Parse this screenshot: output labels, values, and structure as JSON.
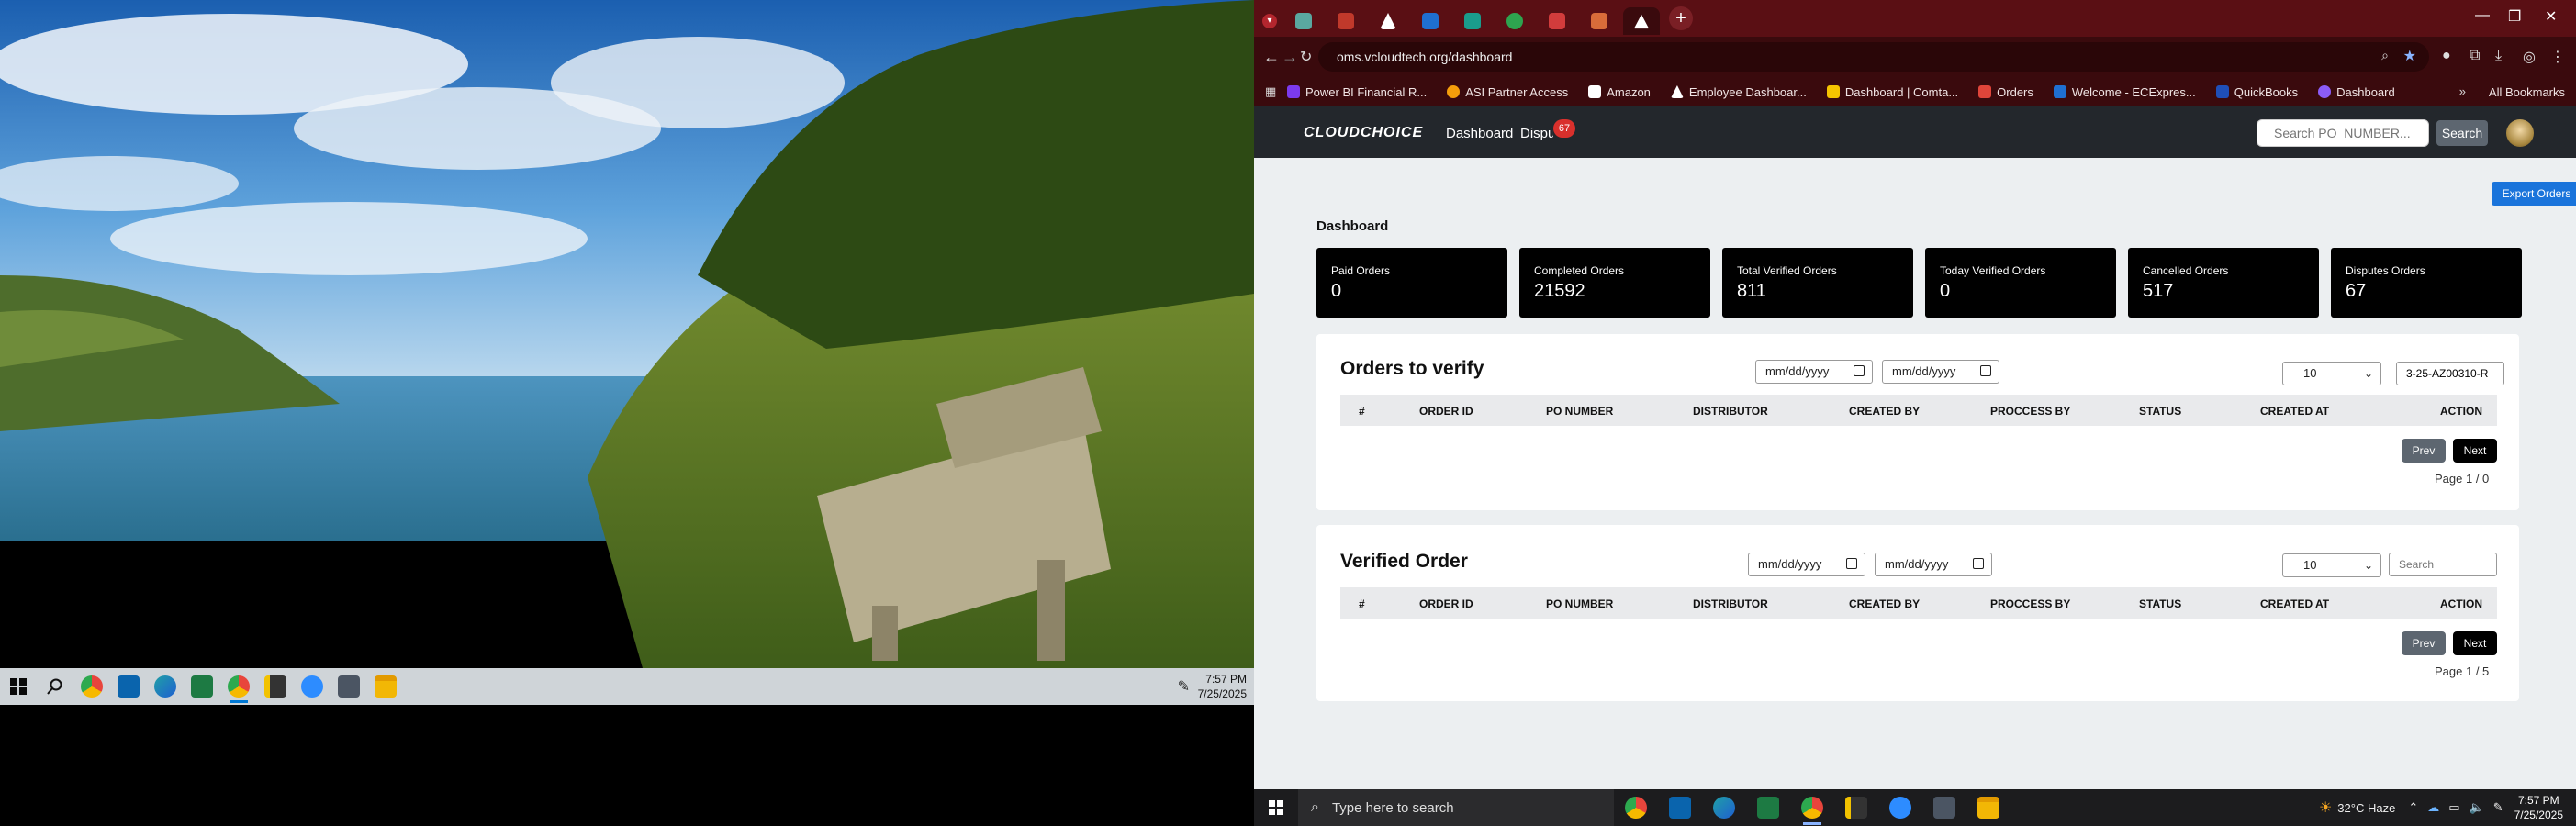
{
  "left_screen": {
    "taskbar": {
      "apps": [
        {
          "name": "windows-start-icon",
          "color": "#0078d4"
        },
        {
          "name": "search-icon",
          "color": "#222222"
        },
        {
          "name": "chrome-icon",
          "color": "#e8453c"
        },
        {
          "name": "outlook-icon",
          "color": "#0a64ad"
        },
        {
          "name": "edge-icon",
          "color": "#1fa0a6"
        },
        {
          "name": "excel-icon",
          "color": "#1d7a43"
        },
        {
          "name": "chrome-profile-icon",
          "color": "#e8453c"
        },
        {
          "name": "sticky-notes-icon",
          "color": "#333333"
        },
        {
          "name": "zoom-icon",
          "color": "#2d8cff"
        },
        {
          "name": "calculator-icon",
          "color": "#4b5563"
        },
        {
          "name": "file-explorer-icon",
          "color": "#f2b705"
        }
      ],
      "time": "7:57 PM",
      "date": "7/25/2025"
    }
  },
  "browser": {
    "tabs": [
      {
        "color": "#5aa8a0"
      },
      {
        "color": "#c0392b"
      },
      {
        "color": "#ffffff"
      },
      {
        "color": "#1f6fd1"
      },
      {
        "color": "#1a9c8c"
      },
      {
        "color": "#2ea44f"
      },
      {
        "color": "#d23c3c"
      },
      {
        "color": "#d86c3a"
      },
      {
        "color": "#ffffff",
        "active": true
      }
    ],
    "url": "oms.vcloudtech.org/dashboard",
    "bookmarks": [
      {
        "label": "Power BI Financial R...",
        "color": "#7c3aed"
      },
      {
        "label": "ASI Partner Access",
        "color": "#f59e0b"
      },
      {
        "label": "Amazon",
        "color": "#111111"
      },
      {
        "label": "Employee Dashboar...",
        "color": "#222222"
      },
      {
        "label": "Dashboard | Comta...",
        "color": "#f5c400"
      },
      {
        "label": "Orders",
        "color": "#e0453a"
      },
      {
        "label": "Welcome - ECExpres...",
        "color": "#1f6fd1"
      },
      {
        "label": "QuickBooks",
        "color": "#1f4fb8"
      },
      {
        "label": "Dashboard",
        "color": "#8b5cf6"
      }
    ],
    "all_bookmarks": "All Bookmarks"
  },
  "app": {
    "logo": "CLOUDCHOICE",
    "nav": {
      "dashboard": "Dashboard",
      "disputes": "Disputes",
      "disputes_badge": "67"
    },
    "search_placeholder": "Search PO_NUMBER...",
    "search_button": "Search",
    "export_button": "Export Orders",
    "page_title": "Dashboard",
    "stats": [
      {
        "label": "Paid Orders",
        "value": "0"
      },
      {
        "label": "Completed Orders",
        "value": "21592"
      },
      {
        "label": "Total Verified Orders",
        "value": "811"
      },
      {
        "label": "Today Verified Orders",
        "value": "0"
      },
      {
        "label": "Cancelled Orders",
        "value": "517"
      },
      {
        "label": "Disputes Orders",
        "value": "67"
      }
    ],
    "columns": [
      "#",
      "ORDER ID",
      "PO NUMBER",
      "DISTRIBUTOR",
      "CREATED BY",
      "PROCCESS BY",
      "STATUS",
      "CREATED AT",
      "ACTION"
    ],
    "orders_to_verify": {
      "title": "Orders to verify",
      "date_from": "mm/dd/yyyy",
      "date_to": "mm/dd/yyyy",
      "page_size": "10",
      "search_value": "3-25-AZ00310-R",
      "prev": "Prev",
      "next": "Next",
      "page_info": "Page 1 / 0"
    },
    "verified_order": {
      "title": "Verified Order",
      "date_from": "mm/dd/yyyy",
      "date_to": "mm/dd/yyyy",
      "page_size": "10",
      "search_placeholder": "Search",
      "prev": "Prev",
      "next": "Next",
      "page_info": "Page 1 / 5"
    }
  },
  "right_taskbar": {
    "search_placeholder": "Type here to search",
    "weather": "32°C  Haze",
    "time": "7:57 PM",
    "date": "7/25/2025"
  }
}
